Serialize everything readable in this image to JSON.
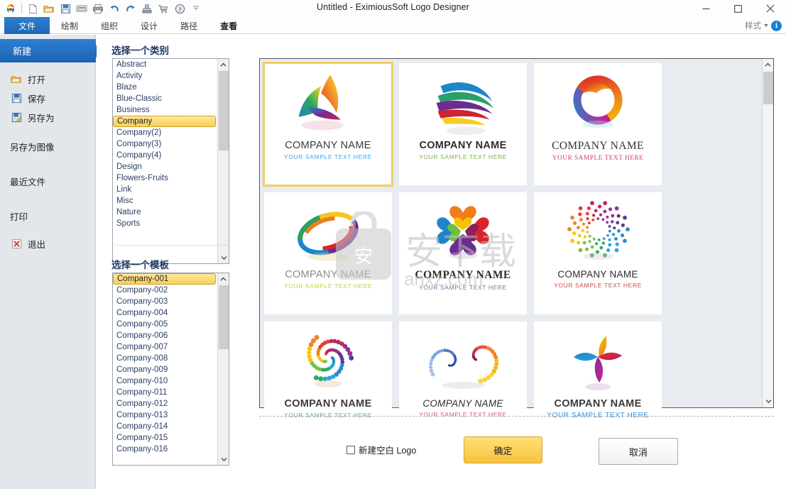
{
  "window": {
    "title": "Untitled - EximiousSoft Logo Designer",
    "minimize": "minimize-icon",
    "maximize": "maximize-icon",
    "close": "close-icon"
  },
  "quick_access": {
    "items": [
      {
        "name": "app-logo-icon",
        "label": "EximiousSoft"
      },
      {
        "name": "new-document-icon",
        "label": "New"
      },
      {
        "name": "open-folder-icon",
        "label": "Open"
      },
      {
        "name": "save-icon",
        "label": "Save"
      },
      {
        "name": "export-icon",
        "label": "Export"
      },
      {
        "name": "print-icon",
        "label": "Print"
      },
      {
        "name": "undo-icon",
        "label": "Undo"
      },
      {
        "name": "redo-icon",
        "label": "Redo"
      },
      {
        "name": "stamp-icon",
        "label": "Stamp"
      },
      {
        "name": "cart-icon",
        "label": "Buy"
      },
      {
        "name": "help-icon",
        "label": "Help"
      },
      {
        "name": "customize-caret-icon",
        "label": "Customize"
      }
    ]
  },
  "ribbon": {
    "tabs": [
      {
        "label": "文件",
        "active": true
      },
      {
        "label": "绘制",
        "active": false
      },
      {
        "label": "组织",
        "active": false
      },
      {
        "label": "设计",
        "active": false
      },
      {
        "label": "路径",
        "active": false
      },
      {
        "label": "查看",
        "active": false
      }
    ],
    "style_label": "样式",
    "info_glyph": "i"
  },
  "sidebar": {
    "items": [
      {
        "label": "新建",
        "icon": "new-icon",
        "selected": true
      },
      {
        "label": "打开",
        "icon": "open-folder-icon",
        "selected": false
      },
      {
        "label": "保存",
        "icon": "save-icon",
        "selected": false
      },
      {
        "label": "另存为",
        "icon": "save-as-icon",
        "selected": false
      },
      {
        "label": "另存为图像",
        "icon": "none",
        "selected": false
      },
      {
        "label": "最近文件",
        "icon": "none",
        "selected": false
      },
      {
        "label": "打印",
        "icon": "none",
        "selected": false
      },
      {
        "label": "退出",
        "icon": "exit-icon",
        "selected": false
      }
    ]
  },
  "category_panel": {
    "title": "选择一个类别",
    "items": [
      "Abstract",
      "Activity",
      "Blaze",
      "Blue-Classic",
      "Business",
      "Company",
      "Company(2)",
      "Company(3)",
      "Company(4)",
      "Design",
      "Flowers-Fruits",
      "Link",
      "Misc",
      "Nature",
      "Sports"
    ],
    "selected": "Company",
    "scroll_up": "scroll-up-icon",
    "scroll_down": "scroll-down-icon"
  },
  "template_panel": {
    "title": "选择一个模板",
    "items": [
      "Company-001",
      "Company-002",
      "Company-003",
      "Company-004",
      "Company-005",
      "Company-006",
      "Company-007",
      "Company-008",
      "Company-009",
      "Company-010",
      "Company-011",
      "Company-012",
      "Company-013",
      "Company-014",
      "Company-015",
      "Company-016"
    ],
    "selected": "Company-001",
    "scroll_up": "scroll-up-icon",
    "scroll_down": "scroll-down-icon"
  },
  "gallery": {
    "scroll_up": "scroll-up-icon",
    "scroll_down": "scroll-down-icon",
    "watermark": {
      "cn": "安下载",
      "domain": "anxz.com",
      "badge": "安"
    },
    "thumbnails": [
      {
        "art": "triskelion",
        "name": "COMPANY NAME",
        "sub": "YOUR SAMPLE TEXT HERE",
        "name_color": "#3b3b3b",
        "sub_color": "#4aa3df",
        "font": "sans",
        "weight": "normal",
        "selected": true
      },
      {
        "art": "swoosh",
        "name": "COMPANY NAME",
        "sub": "YOUR SAMPLE TEXT HERE",
        "name_color": "#2d2d2d",
        "sub_color": "#7fb248",
        "font": "sans",
        "weight": "bold",
        "selected": false
      },
      {
        "art": "spiral-ring",
        "name": "COMPANY NAME",
        "sub": "YOUR SAMPLE TEXT HERE",
        "name_color": "#333333",
        "sub_color": "#d2406a",
        "font": "serif",
        "weight": "normal",
        "selected": false
      },
      {
        "art": "loop-ring",
        "name": "COMPANY NAME",
        "sub": "YOUR SAMPLE TEXT HERE",
        "name_color": "#8a8a8a",
        "sub_color": "#c9cf4a",
        "font": "sans",
        "weight": "normal",
        "selected": false
      },
      {
        "art": "clover-hearts",
        "name": "COMPANY NAME",
        "sub": "YOUR SAMPLE TEXT HERE",
        "name_color": "#2b2b2b",
        "sub_color": "#9a5fb0",
        "font": "serif",
        "weight": "bold",
        "selected": false
      },
      {
        "art": "dot-burst",
        "name": "COMPANY NAME",
        "sub": "YOUR SAMPLE TEXT HERE",
        "name_color": "#2b2b2b",
        "sub_color": "#d04a4a",
        "font": "sans",
        "weight": "normal",
        "selected": false
      },
      {
        "art": "dot-spiral",
        "name": "COMPANY NAME",
        "sub": "YOUR SAMPLE TEXT HERE",
        "name_color": "#3b3b3b",
        "sub_color": "#62b07a",
        "font": "sans",
        "weight": "bold",
        "selected": false
      },
      {
        "art": "double-dot-swirl",
        "name": "COMPANY NAME",
        "sub": "YOUR SAMPLE TEXT HERE",
        "name_color": "#2b2b2b",
        "sub_color": "#d45a72",
        "font": "sans",
        "weight": "normal",
        "selected": false
      },
      {
        "art": "pinwheel",
        "name": "COMPANY NAME",
        "sub": "YOUR SAMPLE TEXT HERE",
        "name_color": "#3b3b3b",
        "sub_color": "#2f8fd8",
        "font": "sans",
        "weight": "bold",
        "selected": false
      }
    ]
  },
  "footer": {
    "checkbox_label": "新建空白 Logo",
    "checkbox_checked": false,
    "ok_label": "确定",
    "cancel_label": "取消"
  },
  "colors": {
    "accent_blue": "#1d67b8",
    "gold": "#f7c23d",
    "gallery_bg": "#e8ecf1",
    "sidebar_bg": "#e3e7ec"
  }
}
